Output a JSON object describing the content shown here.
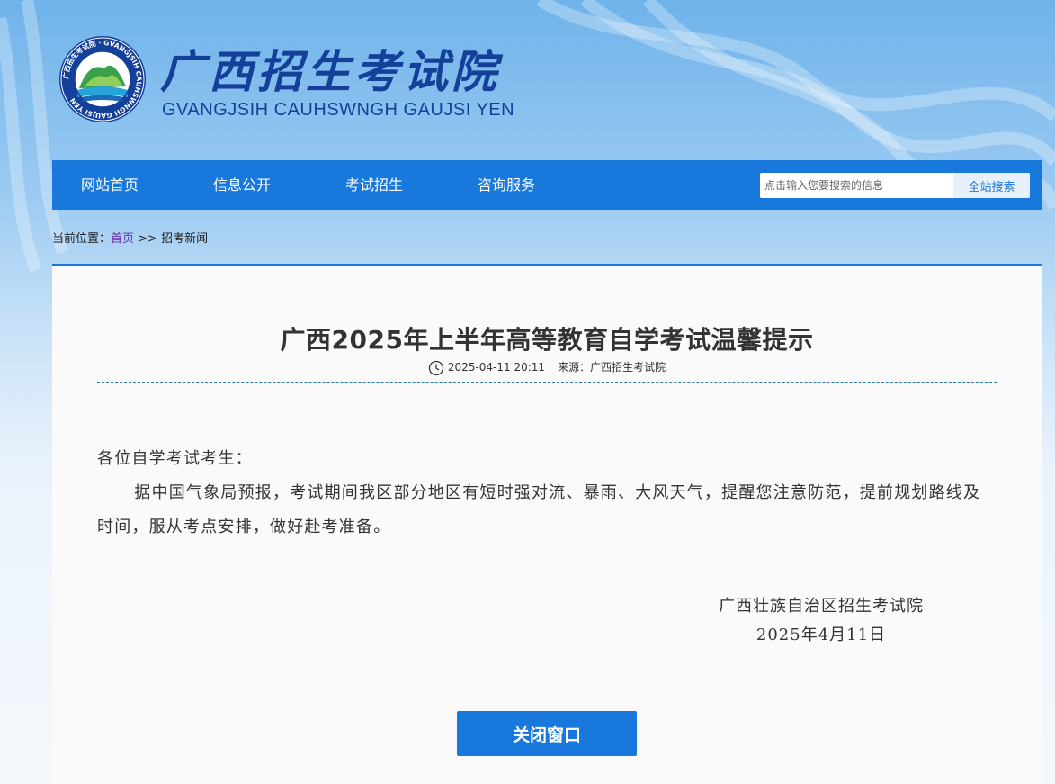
{
  "header": {
    "title": "广西招生考试院",
    "subtitle": "GVANGJSIH CAUHSWNGH GAUJSI YEN",
    "logo_ring_text": "广西招生考试院 · GVANGJSIH CAUHSWNGH GAUJSI YEN"
  },
  "nav": {
    "items": [
      {
        "label": "网站首页"
      },
      {
        "label": "信息公开"
      },
      {
        "label": "考试招生"
      },
      {
        "label": "咨询服务"
      }
    ],
    "search_placeholder": "点击输入您要搜索的信息",
    "search_button": "全站搜索"
  },
  "breadcrumb": {
    "prefix": "当前位置：",
    "home": "首页",
    "separator": " >> ",
    "current": "招考新闻"
  },
  "article": {
    "title": "广西2025年上半年高等教育自学考试温馨提示",
    "date": "2025-04-11 20:11",
    "source": "来源：广西招生考试院",
    "greeting": "各位自学考试考生：",
    "paragraph": "据中国气象局预报，考试期间我区部分地区有短时强对流、暴雨、大风天气，提醒您注意防范，提前规划路线及时间，服从考点安排，做好赴考准备。",
    "signature_org": "广西壮族自治区招生考试院",
    "signature_date": "2025年4月11日"
  },
  "close_button": "关闭窗口",
  "colors": {
    "nav_blue": "#1878dc",
    "title_blue": "#14409a",
    "breadcrumb_link": "#6a2ea8"
  },
  "icons": {
    "logo": "institute-logo",
    "clock": "clock-icon"
  }
}
